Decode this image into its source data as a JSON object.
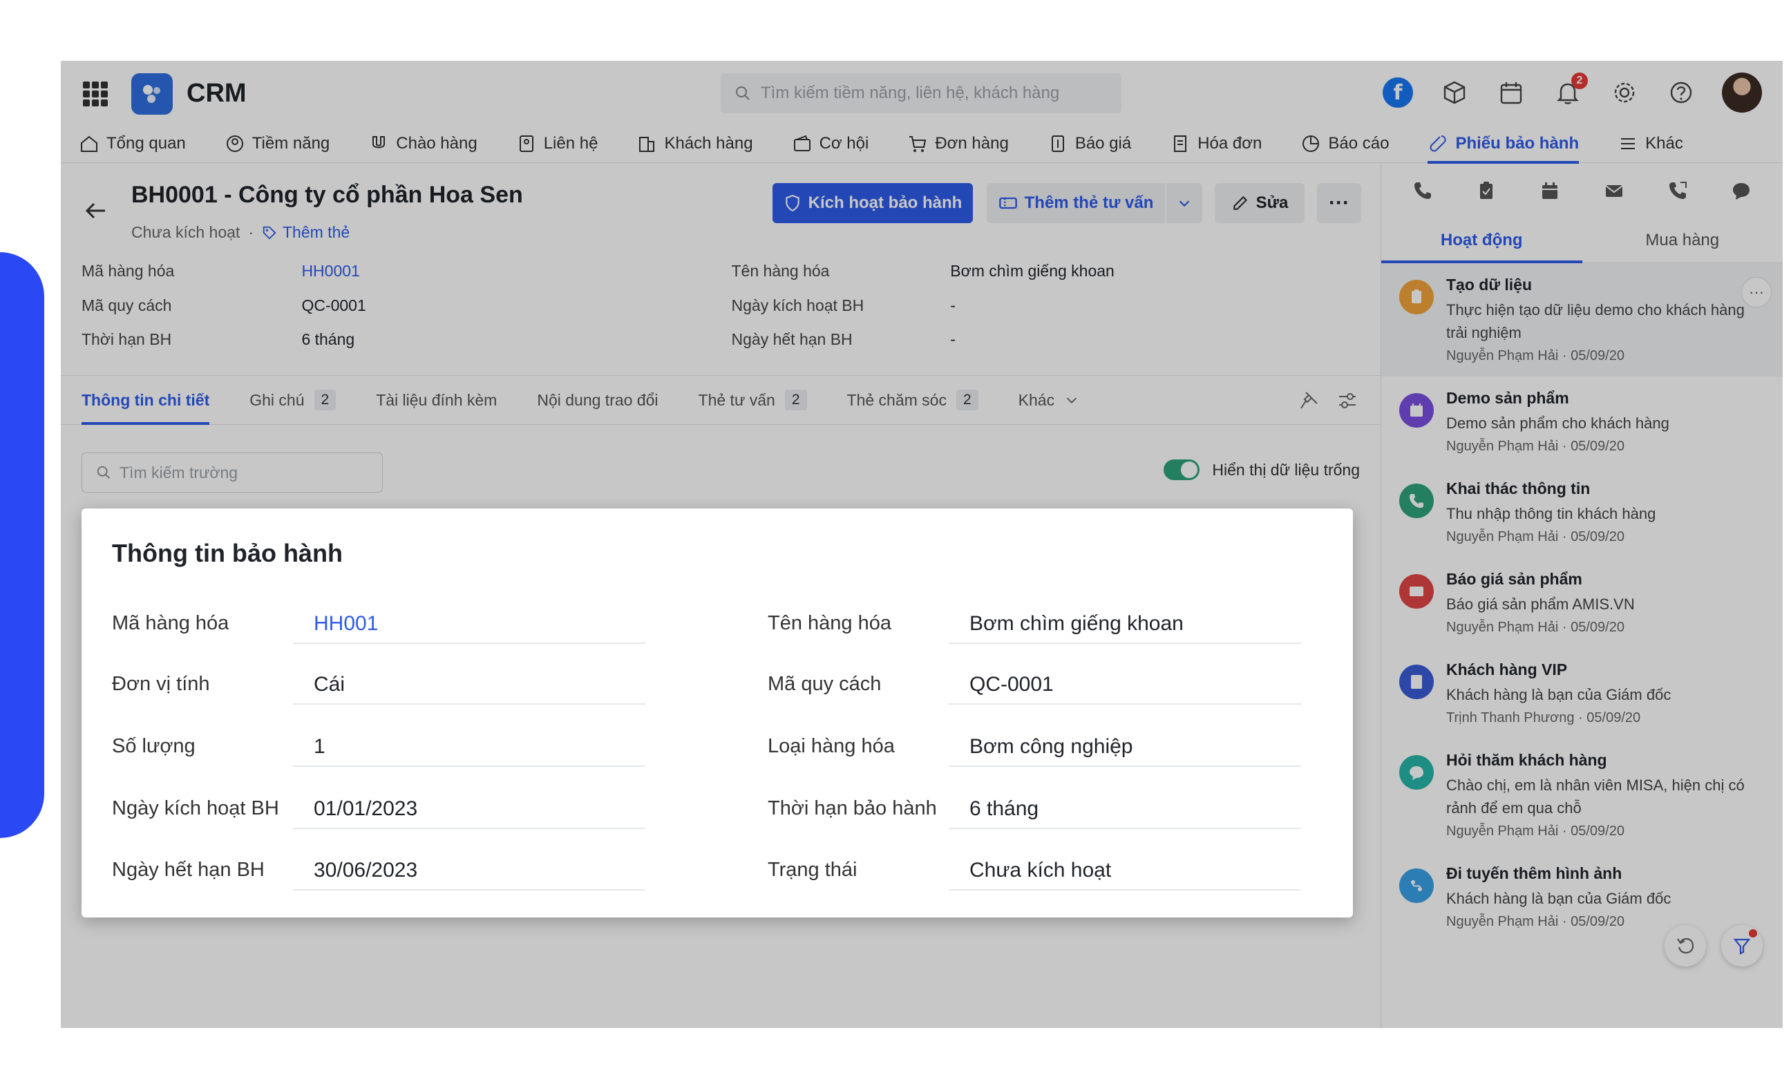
{
  "app": {
    "name": "CRM"
  },
  "search": {
    "placeholder": "Tìm kiếm tiềm năng, liên hệ, khách hàng"
  },
  "header": {
    "notification_count": "2",
    "facebook_label": "f"
  },
  "nav": {
    "items": [
      {
        "label": "Tổng quan",
        "icon": "home-icon"
      },
      {
        "label": "Tiềm năng",
        "icon": "lead-icon"
      },
      {
        "label": "Chào hàng",
        "icon": "magnet-icon"
      },
      {
        "label": "Liên hệ",
        "icon": "contact-icon"
      },
      {
        "label": "Khách hàng",
        "icon": "building-icon"
      },
      {
        "label": "Cơ hội",
        "icon": "wallet-icon"
      },
      {
        "label": "Đơn hàng",
        "icon": "cart-icon"
      },
      {
        "label": "Báo giá",
        "icon": "quote-icon"
      },
      {
        "label": "Hóa đơn",
        "icon": "invoice-icon"
      },
      {
        "label": "Báo cáo",
        "icon": "chart-icon"
      },
      {
        "label": "Phiếu bảo hành",
        "icon": "wrench-icon",
        "active": true
      },
      {
        "label": "Khác",
        "icon": "menu-icon"
      }
    ]
  },
  "record": {
    "title": "BH0001 - Công ty cổ phần Hoa Sen",
    "status": "Chưa kích hoạt",
    "add_tag": "Thêm thẻ",
    "buttons": {
      "activate": "Kích hoạt bảo hành",
      "add_advise": "Thêm thẻ tư vấn",
      "edit": "Sửa",
      "more": "···"
    },
    "summary": [
      {
        "label": "Mã hàng hóa",
        "value": "HH0001",
        "link": true
      },
      {
        "label": "Mã quy cách",
        "value": "QC-0001"
      },
      {
        "label": "Thời hạn BH",
        "value": "6 tháng"
      },
      {
        "label": "Tên hàng hóa",
        "value": "Bơm chìm giếng khoan"
      },
      {
        "label": "Ngày kích hoạt BH",
        "value": "-"
      },
      {
        "label": "Ngày hết hạn BH",
        "value": "-"
      }
    ]
  },
  "tabs": [
    {
      "label": "Thông tin chi tiết",
      "active": true
    },
    {
      "label": "Ghi chú",
      "count": "2"
    },
    {
      "label": "Tài liệu đính kèm"
    },
    {
      "label": "Nội dung trao đổi"
    },
    {
      "label": "Thẻ tư vấn",
      "count": "2"
    },
    {
      "label": "Thẻ chăm sóc",
      "count": "2"
    },
    {
      "label": "Khác"
    }
  ],
  "field_search": {
    "placeholder": "Tìm kiếm trường"
  },
  "toggle": {
    "label": "Hiển thị dữ liệu trống",
    "on": true
  },
  "warranty_card": {
    "title": "Thông tin bảo hành",
    "left": [
      {
        "label": "Mã hàng hóa",
        "value": "HH001",
        "link": true
      },
      {
        "label": "Đơn vị tính",
        "value": "Cái"
      },
      {
        "label": "Số lượng",
        "value": "1"
      },
      {
        "label": "Ngày kích hoạt BH",
        "value": "01/01/2023"
      },
      {
        "label": "Ngày hết hạn BH",
        "value": "30/06/2023"
      }
    ],
    "right": [
      {
        "label": "Tên hàng hóa",
        "value": "Bơm chìm giếng khoan"
      },
      {
        "label": "Mã quy cách",
        "value": "QC-0001"
      },
      {
        "label": "Loại hàng hóa",
        "value": "Bơm công nghiệp"
      },
      {
        "label": "Thời hạn bảo hành",
        "value": "6 tháng"
      },
      {
        "label": "Trạng thái",
        "value": "Chưa kích hoạt"
      }
    ]
  },
  "right_panel": {
    "tabs": [
      {
        "label": "Hoạt động",
        "active": true
      },
      {
        "label": "Mua hàng"
      }
    ],
    "activities": [
      {
        "title": "Tạo dữ liệu",
        "desc": "Thực hiện tạo dữ liệu demo cho khách hàng trải nghiệm",
        "author": "Nguyễn Phạm Hải",
        "date": "05/09/20",
        "color": "#f0a33a",
        "icon": "clipboard-icon"
      },
      {
        "title": "Demo sản phẩm",
        "desc": "Demo sản phẩm cho khách hàng",
        "author": "Nguyễn Phạm Hải",
        "date": "05/09/20",
        "color": "#7b4fe0",
        "icon": "calendar-icon"
      },
      {
        "title": "Khai thác thông tin",
        "desc": "Thu nhập thông tin khách hàng",
        "author": "Nguyễn Phạm Hải",
        "date": "05/09/20",
        "color": "#2ea37b",
        "icon": "phone-icon"
      },
      {
        "title": "Báo giá sản phẩm",
        "desc": "Báo giá sản phẩm AMIS.VN",
        "author": "Nguyễn Phạm Hải",
        "date": "05/09/20",
        "color": "#e04646",
        "icon": "mail-icon"
      },
      {
        "title": "Khách hàng VIP",
        "desc": "Khách hàng là bạn của Giám đốc",
        "author": "Trịnh Thanh Phương",
        "date": "05/09/20",
        "color": "#3a5bd6",
        "icon": "note-icon"
      },
      {
        "title": "Hỏi thăm khách hàng",
        "desc": "Chào chị, em là nhân viên MISA, hiện chị có rảnh để em qua chỗ",
        "author": "Nguyễn Phạm Hải",
        "date": "05/09/20",
        "color": "#27b5a8",
        "icon": "chat-icon"
      },
      {
        "title": "Đi tuyến thêm hình ảnh",
        "desc": "Khách hàng là bạn của Giám đốc",
        "author": "Nguyễn Phạm Hải",
        "date": "05/09/20",
        "color": "#3aa0e8",
        "icon": "route-icon"
      }
    ]
  }
}
